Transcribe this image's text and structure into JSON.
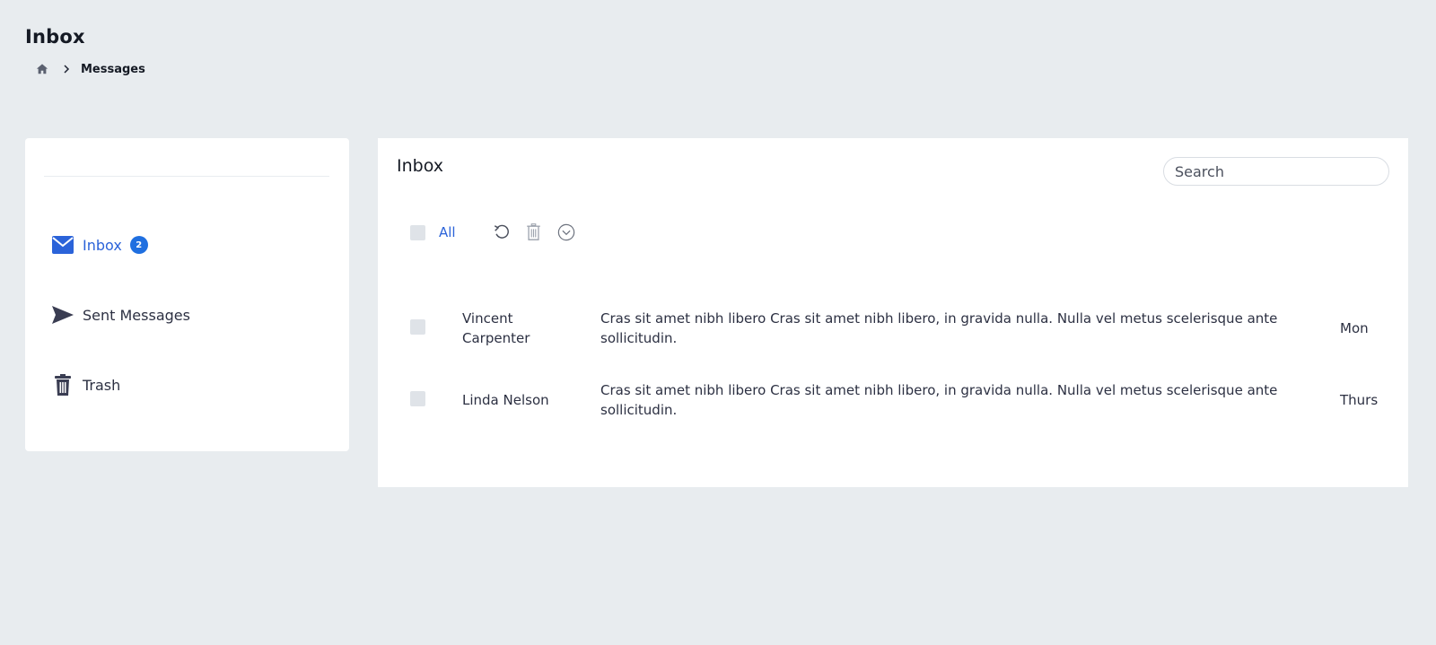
{
  "page": {
    "title": "Inbox",
    "breadcrumb": {
      "home_icon": "home-icon",
      "separator_icon": "chevron-right-icon",
      "current": "Messages"
    }
  },
  "sidebar": {
    "items": [
      {
        "label": "Inbox",
        "icon": "envelope-icon",
        "badge": "2",
        "active": true
      },
      {
        "label": "Sent Messages",
        "icon": "paper-plane-icon",
        "active": false
      },
      {
        "label": "Trash",
        "icon": "trash-icon",
        "active": false
      }
    ]
  },
  "main": {
    "title": "Inbox",
    "search": {
      "placeholder": "Search",
      "value": ""
    },
    "toolbar": {
      "select_all_label": "All",
      "icons": [
        "refresh-icon",
        "trash-icon",
        "chevron-down-circle-icon"
      ]
    },
    "messages": [
      {
        "sender": "Vincent Carpenter",
        "snippet": "Cras sit amet nibh libero Cras sit amet nibh libero, in gravida nulla. Nulla vel metus scelerisque ante sollicitudin.",
        "date": "Mon"
      },
      {
        "sender": "Linda Nelson",
        "snippet": "Cras sit amet nibh libero Cras sit amet nibh libero, in gravida nulla. Nulla vel metus scelerisque ante sollicitudin.",
        "date": "Thurs"
      }
    ]
  },
  "colors": {
    "background": "#e8ecef",
    "accent": "#2b63d9",
    "badge": "#1f6fe0",
    "text": "#2c3042",
    "checkbox": "#dfe3e8"
  }
}
